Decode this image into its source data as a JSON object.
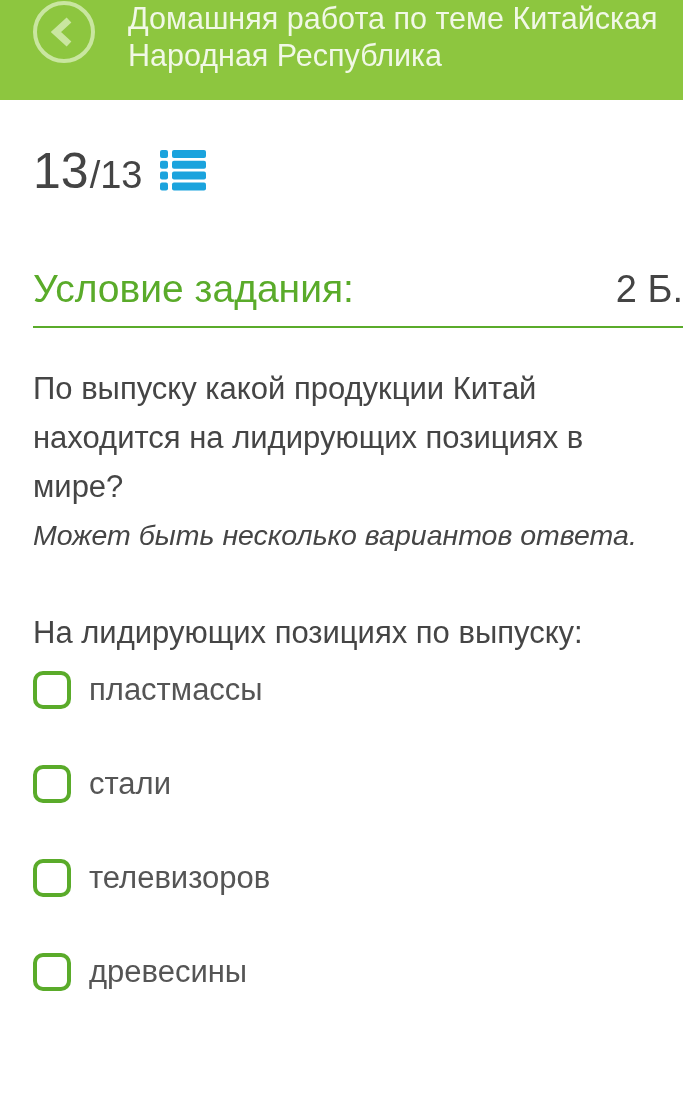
{
  "header": {
    "title": "Домашняя работа по теме Китайская Народная Республика"
  },
  "progress": {
    "current": "13",
    "total": "/13"
  },
  "task": {
    "heading": "Условие задания:",
    "points": "2 Б.",
    "question": "По выпуску какой продукции Китай находится на лидирующих позициях в мире?",
    "hint": "Может быть несколько вариантов ответа.",
    "prompt": "На лидирующих позициях по выпуску:"
  },
  "options": [
    {
      "label": "пластмассы",
      "checked": false
    },
    {
      "label": "стали",
      "checked": false
    },
    {
      "label": "телевизоров",
      "checked": false
    },
    {
      "label": "древесины",
      "checked": false
    }
  ]
}
